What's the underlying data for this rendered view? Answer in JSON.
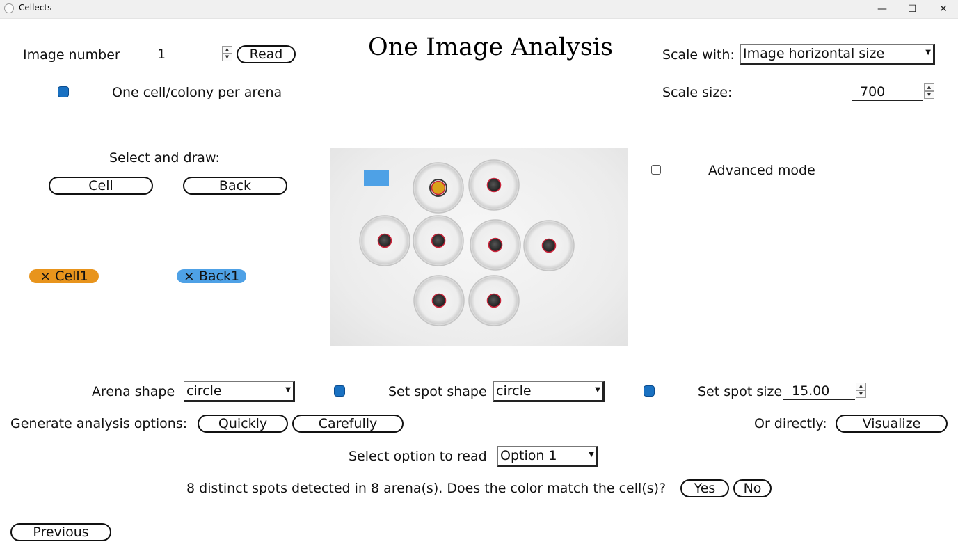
{
  "window": {
    "title": "Cellects",
    "minimize_glyph": "—",
    "maximize_glyph": "☐",
    "close_glyph": "✕"
  },
  "page_title": "One Image Analysis",
  "image_number": {
    "label": "Image number",
    "value": "1",
    "read_button": "Read"
  },
  "one_cell": {
    "label": "One cell/colony per arena",
    "checked": true
  },
  "scale": {
    "with_label": "Scale with:",
    "with_value": "Image horizontal size",
    "size_label": "Scale size:",
    "size_value": "700"
  },
  "select_draw": {
    "label": "Select and draw:",
    "cell_button": "Cell",
    "back_button": "Back"
  },
  "tags": [
    {
      "text": "× Cell1",
      "color": "#e8941c"
    },
    {
      "text": "× Back1",
      "color": "#4ea1e6"
    }
  ],
  "advanced_mode": {
    "label": "Advanced mode",
    "checked": false
  },
  "arena": {
    "label": "Arena shape",
    "value": "circle",
    "checked": true
  },
  "spot_shape": {
    "label": "Set spot shape",
    "value": "circle",
    "checked": true
  },
  "spot_size": {
    "label": "Set spot size",
    "value": "15.00"
  },
  "generate": {
    "label": "Generate analysis options:",
    "quickly": "Quickly",
    "carefully": "Carefully"
  },
  "directly": {
    "label": "Or directly:",
    "visualize": "Visualize"
  },
  "option_select": {
    "label": "Select option to read",
    "value": "Option 1"
  },
  "detection": {
    "message": "8 distinct spots detected in 8 arena(s). Does the color match the cell(s)?",
    "yes": "Yes",
    "no": "No"
  },
  "previous_button": "Previous",
  "colors": {
    "checkbox_blue": "#1971c2",
    "cell_tag": "#e8941c",
    "back_tag": "#4ea1e6",
    "spot_outline": "#c8243a",
    "selected_spot_fill": "#d9a21a",
    "back_marker": "#4ea1e6"
  }
}
